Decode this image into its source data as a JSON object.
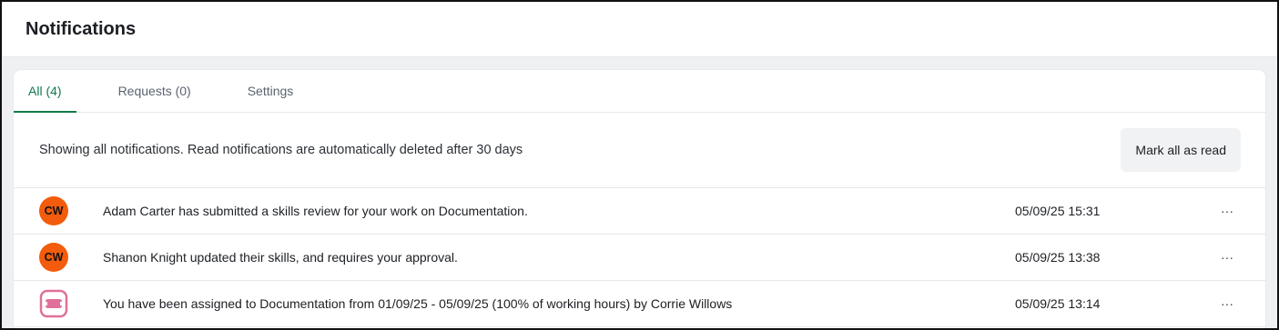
{
  "header": {
    "title": "Notifications"
  },
  "tabs": [
    {
      "label": "All (4)",
      "active": true
    },
    {
      "label": "Requests (0)",
      "active": false
    },
    {
      "label": "Settings",
      "active": false
    }
  ],
  "info": {
    "text": "Showing all notifications. Read notifications are automatically deleted after 30 days",
    "mark_all_label": "Mark all as read"
  },
  "notifications": [
    {
      "icon": "avatar",
      "initials": "CW",
      "message": "Adam Carter has submitted a skills review for your work on Documentation.",
      "time": "05/09/25 15:31",
      "more": "···"
    },
    {
      "icon": "avatar",
      "initials": "CW",
      "message": "Shanon Knight updated their skills, and requires your approval.",
      "time": "05/09/25 13:38",
      "more": "···"
    },
    {
      "icon": "assignment-icon",
      "message": "You have been assigned to Documentation from 01/09/25 - 05/09/25 (100% of working hours) by Corrie Willows",
      "time": "05/09/25 13:14",
      "more": "···"
    }
  ],
  "colors": {
    "accent": "#117a4a",
    "avatar_bg": "#f25c0c",
    "assignment_icon": "#e0709a"
  }
}
